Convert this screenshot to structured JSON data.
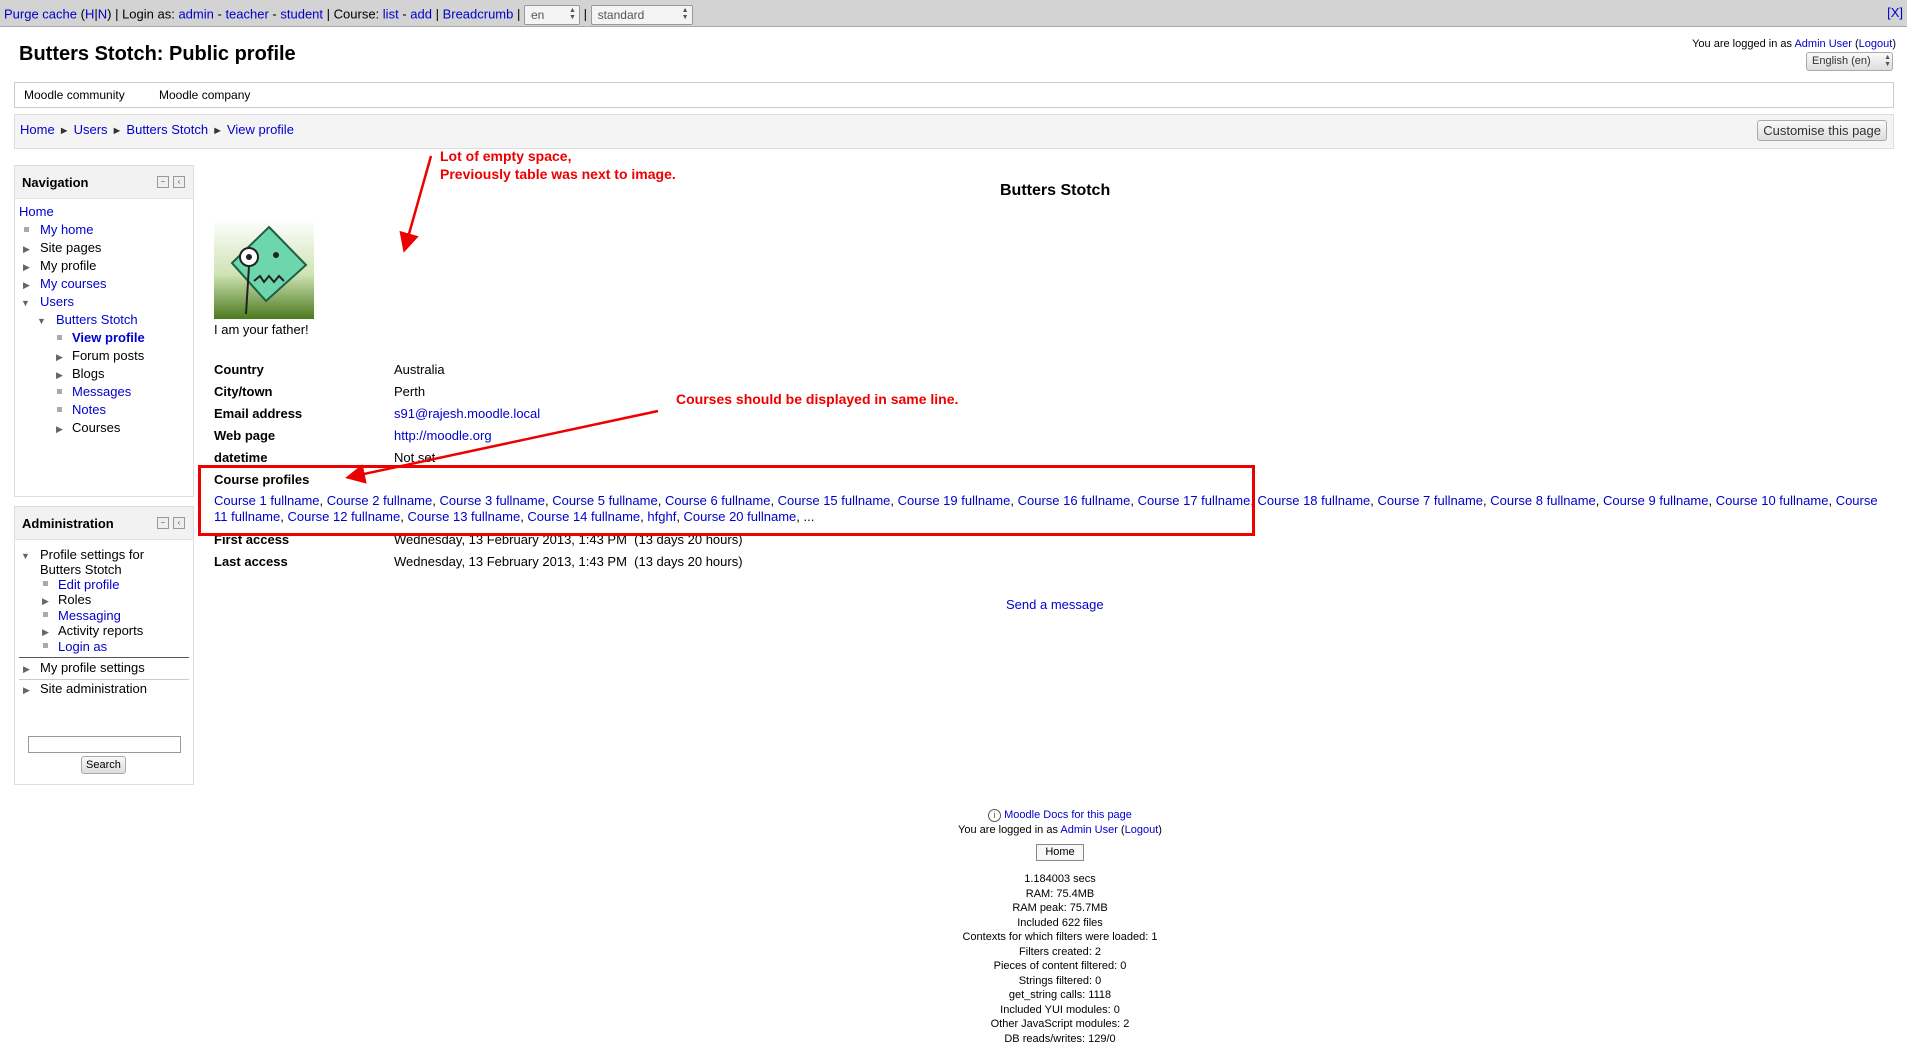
{
  "devbar": {
    "purge": "Purge cache",
    "purge_h": "H",
    "purge_n": "N",
    "login_as_label": "Login as:",
    "login_admin": "admin",
    "login_teacher": "teacher",
    "login_student": "student",
    "course_label": "Course:",
    "course_list": "list",
    "course_add": "add",
    "breadcrumb": "Breadcrumb",
    "lang_value": "en",
    "theme_value": "standard",
    "close": "[X]"
  },
  "header": {
    "title": "Butters Stotch: Public profile",
    "logged_in_prefix": "You are logged in as",
    "user": "Admin User",
    "logout": "Logout",
    "language": "English (en)"
  },
  "custommenu": [
    "Moodle community",
    "Moodle company"
  ],
  "breadcrumb": [
    "Home",
    "Users",
    "Butters Stotch",
    "View profile"
  ],
  "customise_button": "Customise this page",
  "navigation": {
    "title": "Navigation",
    "home": "Home",
    "my_home": "My home",
    "site_pages": "Site pages",
    "my_profile": "My profile",
    "my_courses": "My courses",
    "users": "Users",
    "butters": "Butters Stotch",
    "view_profile": "View profile",
    "forum_posts": "Forum posts",
    "blogs": "Blogs",
    "messages": "Messages",
    "notes": "Notes",
    "courses": "Courses"
  },
  "administration": {
    "title": "Administration",
    "profile_settings_1": "Profile settings for",
    "profile_settings_2": "Butters Stotch",
    "edit_profile": "Edit profile",
    "roles": "Roles",
    "messaging": "Messaging",
    "activity_reports": "Activity reports",
    "login_as": "Login as",
    "my_profile_settings": "My profile settings",
    "site_admin": "Site administration",
    "search_button": "Search"
  },
  "profile": {
    "fullname": "Butters Stotch",
    "description": "I am your father!",
    "country_label": "Country",
    "country": "Australia",
    "city_label": "City/town",
    "city": "Perth",
    "email_label": "Email address",
    "email": "s91@rajesh.moodle.local",
    "web_label": "Web page",
    "web": "http://moodle.org",
    "datetime_label": "datetime",
    "datetime": "Not set",
    "course_profiles_label": "Course profiles",
    "courses": [
      "Course 1 fullname",
      "Course 2 fullname",
      "Course 3 fullname",
      "Course 5 fullname",
      "Course 6 fullname",
      "Course 15 fullname",
      "Course 19 fullname",
      "Course 16 fullname",
      "Course 17 fullname",
      "Course 18 fullname",
      "Course 7 fullname",
      "Course 8 fullname",
      "Course 9 fullname",
      "Course 10 fullname",
      "Course 11 fullname",
      "Course 12 fullname",
      "Course 13 fullname",
      "Course 14 fullname",
      "hfghf",
      "Course 20 fullname"
    ],
    "courses_more": "...",
    "first_access_label": "First access",
    "first_access": "Wednesday, 13 February 2013, 1:43 PM  (13 days 20 hours)",
    "last_access_label": "Last access",
    "last_access": "Wednesday, 13 February 2013, 1:43 PM  (13 days 20 hours)",
    "send_message": "Send a message"
  },
  "annotations": {
    "empty_space_1": "Lot of empty space,",
    "empty_space_2": "Previously table was next to image.",
    "same_line": "Courses should be displayed in same line."
  },
  "footer": {
    "docs": "Moodle Docs for this page",
    "logged_in_prefix": "You are logged in as",
    "user": "Admin User",
    "logout": "Logout",
    "home_button": "Home",
    "perf": [
      "1.184003 secs",
      "RAM: 75.4MB",
      "RAM peak: 75.7MB",
      "Included 622 files",
      "Contexts for which filters were loaded: 1",
      "Filters created: 2",
      "Pieces of content filtered: 0",
      "Strings filtered: 0",
      "get_string calls: 1118",
      "Included YUI modules: 0",
      "Other JavaScript modules: 2",
      "DB reads/writes: 129/0"
    ]
  },
  "colors": {
    "link": "#0000cc",
    "annotation": "#ee0000",
    "devbar": "#d3d3d3"
  }
}
